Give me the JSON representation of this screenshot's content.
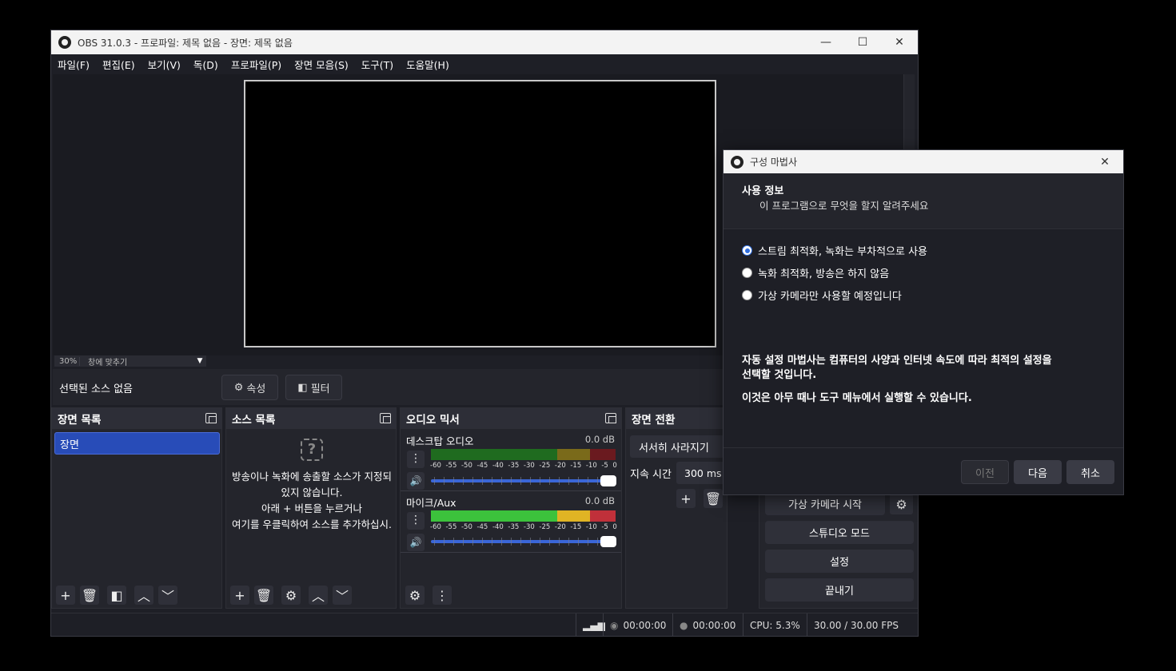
{
  "main_window": {
    "title": "OBS 31.0.3 - 프로파일: 제목 없음 - 장면: 제목 없음",
    "controls": {
      "minimize": "—",
      "maximize": "☐",
      "close": "✕"
    },
    "menu": [
      "파일(F)",
      "편집(E)",
      "보기(V)",
      "독(D)",
      "프로파일(P)",
      "장면 모음(S)",
      "도구(T)",
      "도움말(H)"
    ],
    "zoom": {
      "percent": "30%",
      "mode": "창에 맞추기"
    },
    "source_bar": {
      "no_selection": "선택된 소스 없음",
      "properties": "속성",
      "filters": "필터"
    },
    "docks": {
      "scenes": {
        "title": "장면 목록",
        "items": [
          "장면"
        ]
      },
      "sources": {
        "title": "소스 목록",
        "empty_lines": [
          "방송이나 녹화에 송출할 소스가 지정되",
          "있지 않습니다.",
          "아래 + 버튼을 누르거나",
          "여기를 우클릭하여 소스를 추가하십시."
        ]
      },
      "mixer": {
        "title": "오디오 믹서",
        "channels": [
          {
            "name": "데스크탑 오디오",
            "db": "0.0 dB"
          },
          {
            "name": "마이크/Aux",
            "db": "0.0 dB"
          }
        ],
        "scale": [
          "-60",
          "-55",
          "-50",
          "-45",
          "-40",
          "-35",
          "-30",
          "-25",
          "-20",
          "-15",
          "-10",
          "-5",
          "0"
        ]
      },
      "transitions": {
        "title": "장면 전환",
        "selected": "서서히 사라지기",
        "duration_label": "지속 시간",
        "duration": "300 ms"
      },
      "controls": {
        "buttons": [
          "가상 카메라 시작",
          "스튜디오 모드",
          "설정",
          "끝내기"
        ]
      }
    },
    "status": {
      "stream_time": "00:00:00",
      "record_time": "00:00:00",
      "cpu": "CPU: 5.3%",
      "fps": "30.00 / 30.00 FPS"
    }
  },
  "wizard": {
    "title": "구성 마법사",
    "heading": "사용 정보",
    "subheading": "이 프로그램으로 무엇을 할지 알려주세요",
    "options": [
      {
        "label": "스트림 최적화, 녹화는 부차적으로 사용",
        "selected": true
      },
      {
        "label": "녹화 최적화, 방송은 하지 않음",
        "selected": false
      },
      {
        "label": "가상 카메라만 사용할 예정입니다",
        "selected": false
      }
    ],
    "info1_line1": "자동 설정 마법사는 컴퓨터의 사양과 인터넷 속도에 따라 최적의 설정을",
    "info1_line2": "선택할 것입니다.",
    "info2": "이것은 아무 때나 도구 메뉴에서 실행할 수 있습니다.",
    "buttons": {
      "back": "이전",
      "next": "다음",
      "cancel": "취소"
    }
  }
}
